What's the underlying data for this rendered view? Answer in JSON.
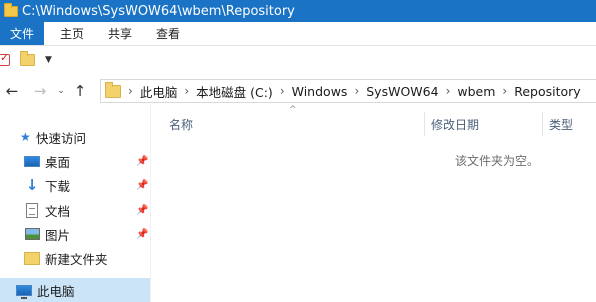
{
  "window": {
    "title": "C:\\Windows\\SysWOW64\\wbem\\Repository"
  },
  "ribbon": {
    "tabs": [
      {
        "label": "文件"
      },
      {
        "label": "主页"
      },
      {
        "label": "共享"
      },
      {
        "label": "查看"
      }
    ]
  },
  "quick_access_toolbar": {
    "icons": [
      "properties-check-icon",
      "new-folder-icon",
      "customize-dropdown-icon"
    ]
  },
  "navigation": {
    "back_icon": "←",
    "forward_icon": "→",
    "recent_icon": "⌄",
    "up_icon": "↑"
  },
  "address_bar": {
    "separator": "›",
    "breadcrumbs": [
      "此电脑",
      "本地磁盘 (C:)",
      "Windows",
      "SysWOW64",
      "wbem",
      "Repository"
    ]
  },
  "nav_pane": {
    "items": [
      {
        "label": "快速访问",
        "icon": "star-icon",
        "pinned": false
      },
      {
        "label": "桌面",
        "icon": "desktop-icon",
        "pinned": true
      },
      {
        "label": "下载",
        "icon": "download-icon",
        "pinned": true
      },
      {
        "label": "文档",
        "icon": "document-icon",
        "pinned": true
      },
      {
        "label": "图片",
        "icon": "picture-icon",
        "pinned": true
      },
      {
        "label": "新建文件夹",
        "icon": "folder-icon",
        "pinned": false
      },
      {
        "label": "此电脑",
        "icon": "computer-icon",
        "pinned": false,
        "selected": true
      }
    ],
    "pin_glyph": "📌"
  },
  "content": {
    "columns": [
      {
        "label": "名称"
      },
      {
        "label": "修改日期"
      },
      {
        "label": "类型"
      }
    ],
    "sort_indicator": "^",
    "empty_message": "该文件夹为空。"
  },
  "colors": {
    "titlebar": "#1a73c4",
    "file_tab": "#1a73c4",
    "selected_nav": "#cce4f7"
  }
}
